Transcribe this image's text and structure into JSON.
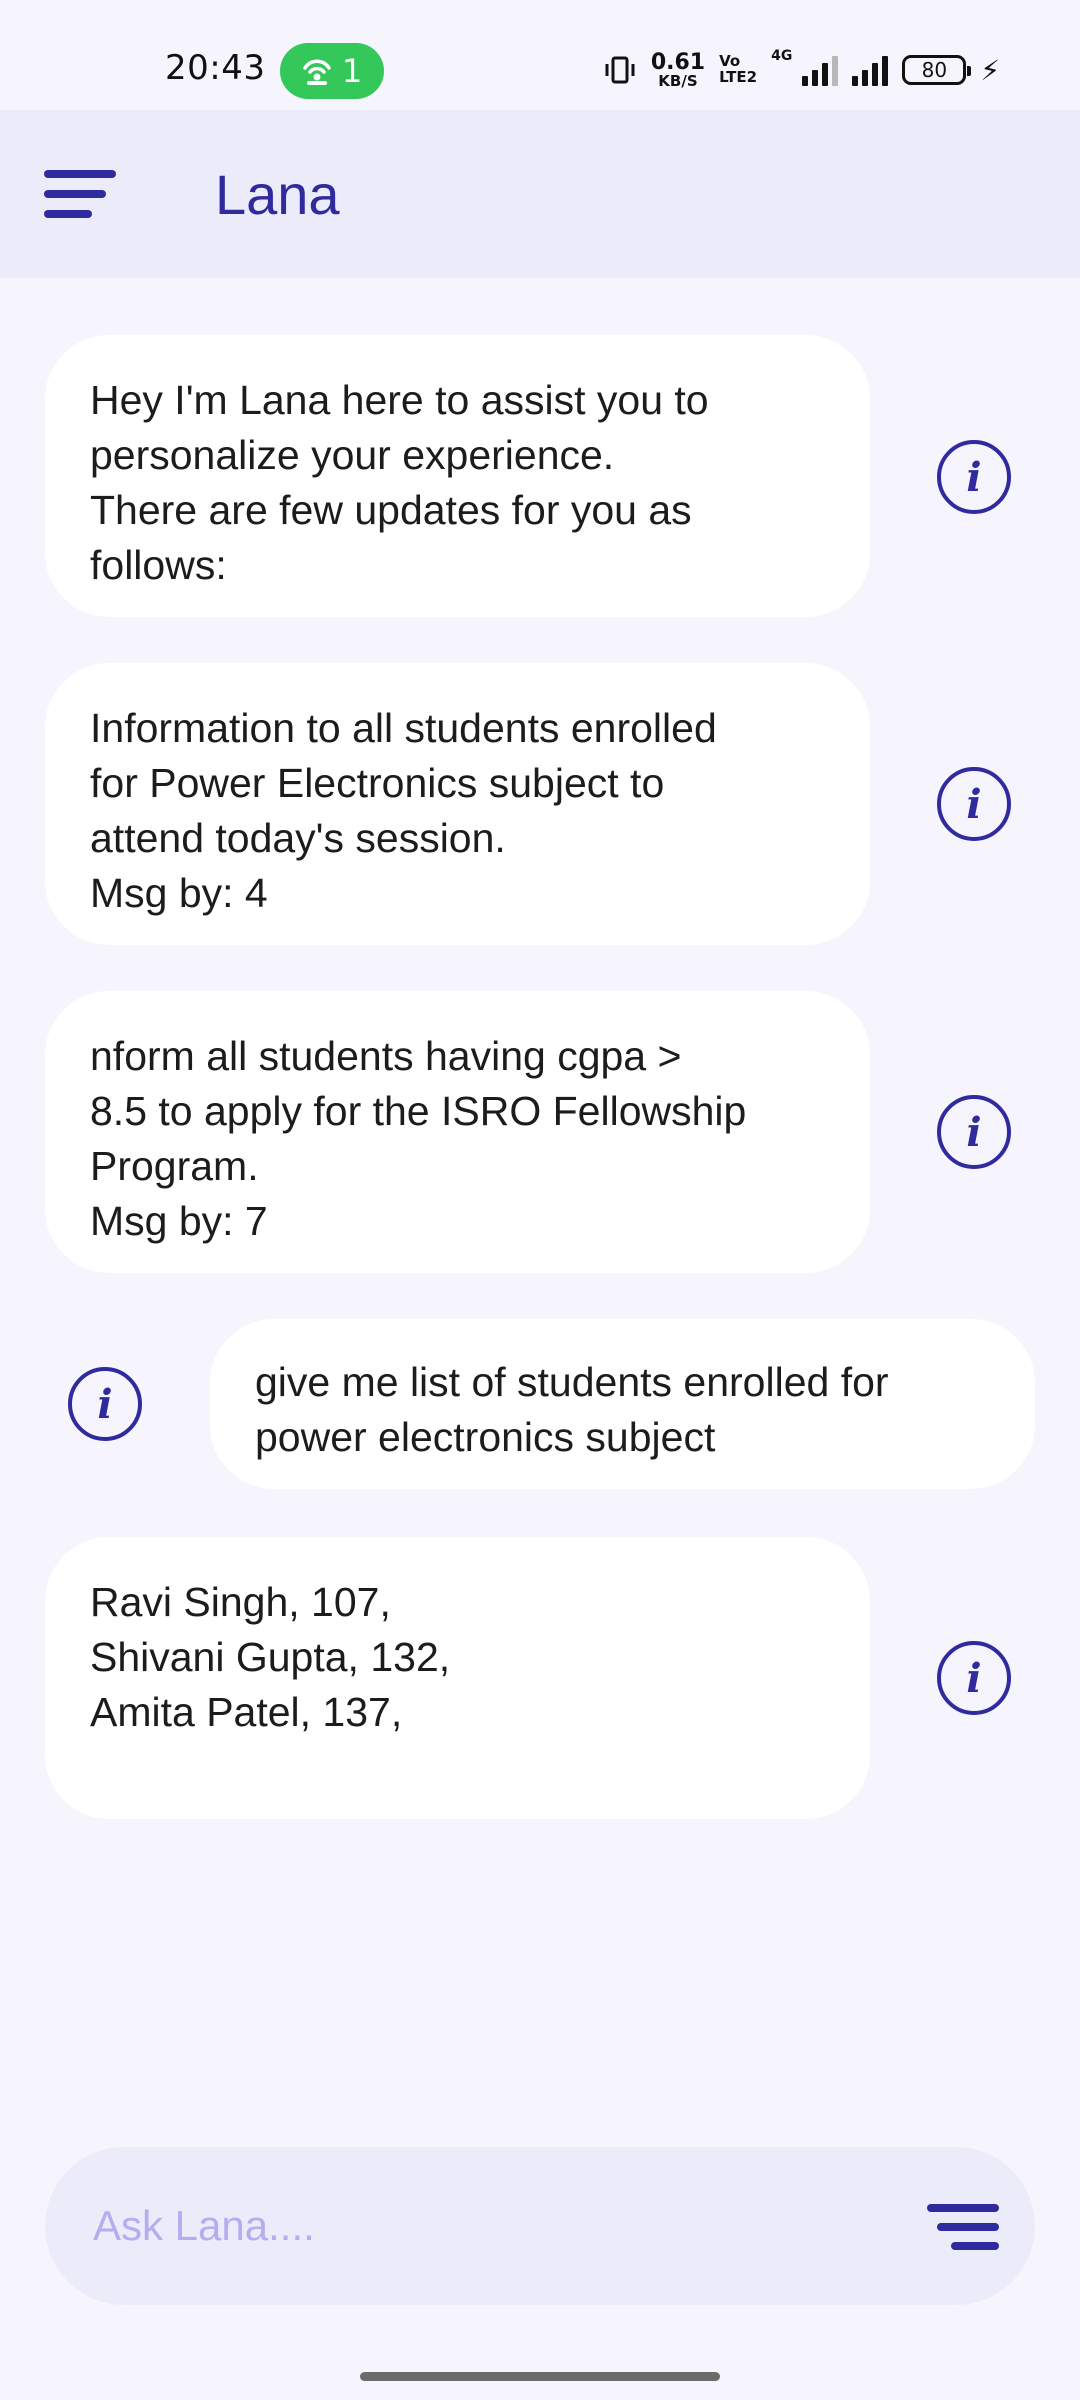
{
  "status_bar": {
    "time": "20:43",
    "hotspot_count": "1",
    "net_speed_value": "0.61",
    "net_speed_unit": "KB/S",
    "volte_top": "Vo",
    "volte_bottom": "LTE2",
    "network_type": "4G",
    "battery_level": "80"
  },
  "header": {
    "title": "Lana"
  },
  "messages": [
    {
      "sender": "bot",
      "text": "Hey I'm Lana here to assist you to\npersonalize your experience.\nThere are few updates for you as\nfollows:"
    },
    {
      "sender": "bot",
      "text": "Information to all students enrolled\nfor Power Electronics subject to\nattend today's session.\nMsg by: 4"
    },
    {
      "sender": "bot",
      "text": "nform all students having cgpa >\n8.5 to apply for the ISRO Fellowship\nProgram.\nMsg by: 7"
    },
    {
      "sender": "user",
      "text": "give me list of students enrolled for\npower electronics subject"
    },
    {
      "sender": "bot",
      "text": "Ravi Singh, 107,\nShivani Gupta, 132,\nAmita Patel, 137,"
    }
  ],
  "info_icon_glyph": "i",
  "input": {
    "placeholder": "Ask Lana....",
    "value": ""
  },
  "colors": {
    "accent": "#2f2b9e",
    "header_bg": "#ecebfa",
    "page_bg": "#f6f5fd",
    "bubble_bg": "#ffffff",
    "placeholder": "#b3aef0",
    "hotspot": "#34c759"
  }
}
